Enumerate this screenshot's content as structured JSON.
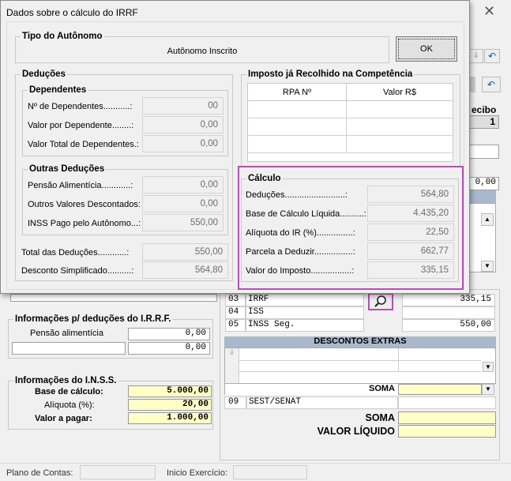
{
  "dialog": {
    "title": "Dados sobre o cálculo do IRRF",
    "tipo_autonomo": {
      "title": "Tipo do Autônomo",
      "value": "Autônomo Inscrito",
      "ok_label": "OK"
    },
    "deducoes": {
      "title": "Deduções",
      "dependentes": {
        "title": "Dependentes",
        "rows": [
          {
            "label": "Nº de Dependentes...........:",
            "value": "00"
          },
          {
            "label": "Valor por Dependente........:",
            "value": "0,00"
          },
          {
            "label": "Valor Total de Dependentes.:",
            "value": "0,00"
          }
        ]
      },
      "outras": {
        "title": "Outras Deduções",
        "rows": [
          {
            "label": "Pensão Alimentícia............:",
            "value": "0,00"
          },
          {
            "label": "Outros Valores Descontados:",
            "value": "0,00"
          },
          {
            "label": "INSS Pago pelo Autônomo...:",
            "value": "550,00"
          }
        ]
      },
      "total": {
        "label": "Total das Deduções............:",
        "value": "550,00"
      },
      "desconto": {
        "label": "Desconto Simplificado..........:",
        "value": "564,80"
      }
    },
    "imposto": {
      "title": "Imposto já Recolhido na Competência",
      "col1": "RPA Nº",
      "col2": "Valor R$"
    },
    "calculo": {
      "title": "Cálculo",
      "rows": [
        {
          "label": "Deduções.........................:",
          "value": "564,80"
        },
        {
          "label": "Base de Cálculo Líquida..........:",
          "value": "4.435,20"
        },
        {
          "label": "Alíquota do IR (%)...............:",
          "value": "22,50"
        },
        {
          "label": "Parcela a Deduzir................:",
          "value": "662,77"
        },
        {
          "label": "Valor do Imposto.................:",
          "value": "335,15"
        }
      ]
    }
  },
  "background": {
    "close": "✕",
    "recibo_label": "ecibo",
    "recibo_value": "1",
    "right_value": "0,00",
    "irrf_rows": [
      {
        "code": "03",
        "name": "IRRF",
        "value": "335,15"
      },
      {
        "code": "04",
        "name": "ISS",
        "value": ""
      },
      {
        "code": "05",
        "name": "INSS Seg.",
        "value": "550,00"
      }
    ],
    "descontos_extras": "DESCONTOS EXTRAS",
    "soma": "SOMA",
    "sest_code": "09",
    "sest_name": "SEST/SENAT",
    "soma2": "SOMA",
    "valor_liquido": "VALOR LÍQUIDO",
    "deducoes_irrf": {
      "title": "Informações p/ deduções do I.R.R.F.",
      "pensao_label": "Pensão alimentícia",
      "v1": "0,00",
      "v2": "0,00"
    },
    "inss": {
      "title": "Informações do I.N.S.S.",
      "base_label": "Base de cálculo:",
      "base_value": "5.000,00",
      "aliquota_label": "Alíquota (%):",
      "aliquota_value": "20,00",
      "valor_label": "Valor a pagar:",
      "valor_value": "1.000,00"
    },
    "footer": {
      "plano_label": "Plano de Contas:",
      "inicio_label": "Inicio Exercício:"
    }
  }
}
